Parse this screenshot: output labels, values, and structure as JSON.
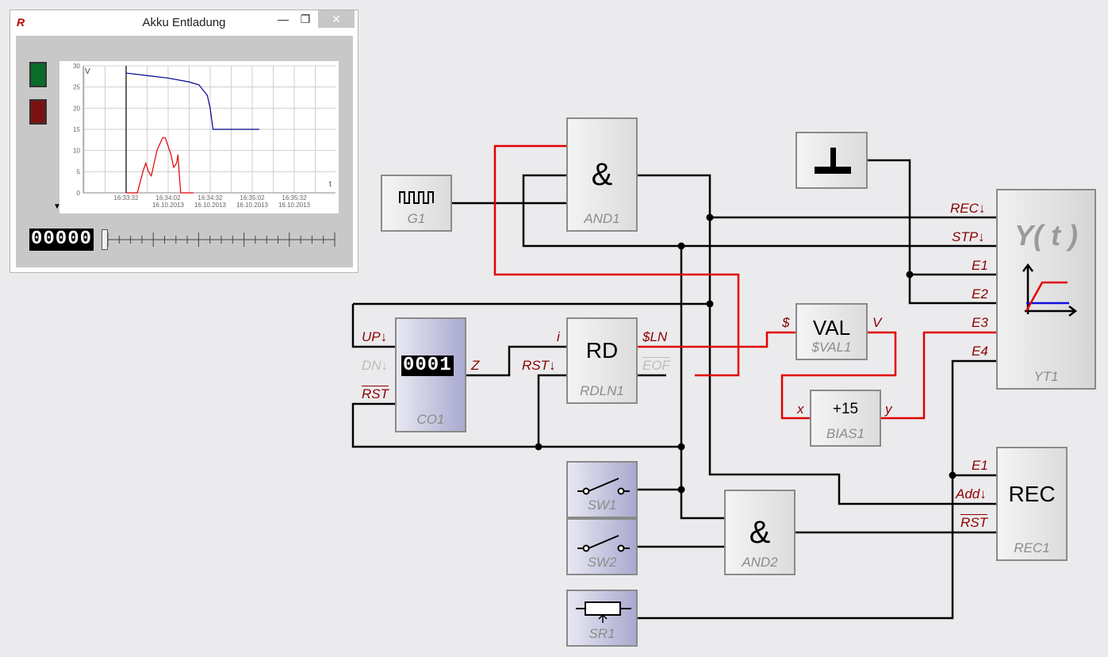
{
  "window": {
    "title": "Akku Entladung",
    "min_glyph": "—",
    "max_glyph": "❐",
    "close_glyph": "✕",
    "counter": "00000",
    "plot": {
      "y_label": "V",
      "x_label": "t",
      "y_ticks": [
        "30",
        "25",
        "20",
        "15",
        "10",
        "5",
        "0"
      ],
      "x_ticks": [
        {
          "time": "16:33:32",
          "date": ""
        },
        {
          "time": "16:34:02",
          "date": "16.10.2013"
        },
        {
          "time": "16:34:32",
          "date": "16.10.2013"
        },
        {
          "time": "16:35:02",
          "date": "16.10.2013"
        },
        {
          "time": "16:35:32",
          "date": "16.10.2013"
        }
      ]
    }
  },
  "chart_data": {
    "type": "line",
    "xlabel": "t",
    "ylabel": "V",
    "ylim": [
      0,
      30
    ],
    "grid": true,
    "series": [
      {
        "color": "#00008b",
        "points": [
          [
            0,
            28.3
          ],
          [
            15,
            27.7
          ],
          [
            30,
            27.1
          ],
          [
            45,
            26.2
          ],
          [
            52,
            25.5
          ],
          [
            58,
            23
          ],
          [
            60,
            20
          ],
          [
            62,
            15
          ],
          [
            95,
            15
          ]
        ]
      },
      {
        "color": "#e00000",
        "points": [
          [
            0,
            0
          ],
          [
            8,
            0
          ],
          [
            12,
            5
          ],
          [
            14,
            7
          ],
          [
            16,
            5
          ],
          [
            18,
            4
          ],
          [
            22,
            10
          ],
          [
            26,
            13
          ],
          [
            28,
            13
          ],
          [
            30,
            11
          ],
          [
            32,
            9
          ],
          [
            34,
            6
          ],
          [
            36,
            7
          ],
          [
            37,
            9
          ],
          [
            38,
            4
          ],
          [
            39,
            0
          ],
          [
            48,
            0
          ]
        ]
      }
    ]
  },
  "colors": {
    "wire": "#000000",
    "signal": "#e00000"
  },
  "blocks": {
    "g1": {
      "label": "G1",
      "icon": "pulse-generator-icon"
    },
    "and1": {
      "symbol": "&",
      "label": "AND1"
    },
    "and2": {
      "symbol": "&",
      "label": "AND2"
    },
    "co1": {
      "label": "CO1",
      "value": "0001",
      "pins": {
        "up": "UP↓",
        "dn": "DN↓",
        "rst": "RST",
        "z": "Z"
      }
    },
    "rdln1": {
      "title": "RD",
      "label": "RDLN1",
      "pins": {
        "i": "i",
        "rst": "RST↓",
        "sln": "$LN",
        "eof": "EOF"
      }
    },
    "val1": {
      "title": "VAL",
      "label": "$VAL1",
      "pins": {
        "in": "$",
        "out": "V"
      }
    },
    "bias1": {
      "title": "+15",
      "label": "BIAS1",
      "pins": {
        "x": "x",
        "y": "y"
      }
    },
    "yt1": {
      "title": "Y( t )",
      "label": "YT1",
      "pins": {
        "rec": "REC↓",
        "stp": "STP↓",
        "e1": "E1",
        "e2": "E2",
        "e3": "E3",
        "e4": "E4"
      }
    },
    "rec1": {
      "title": "REC",
      "label": "REC1",
      "pins": {
        "e1": "E1",
        "add": "Add↓",
        "rst": "RST"
      }
    },
    "sw1": {
      "label": "SW1"
    },
    "sw2": {
      "label": "SW2"
    },
    "sr1": {
      "label": "SR1"
    },
    "gnd": {
      "icon": "push-button-icon"
    }
  }
}
